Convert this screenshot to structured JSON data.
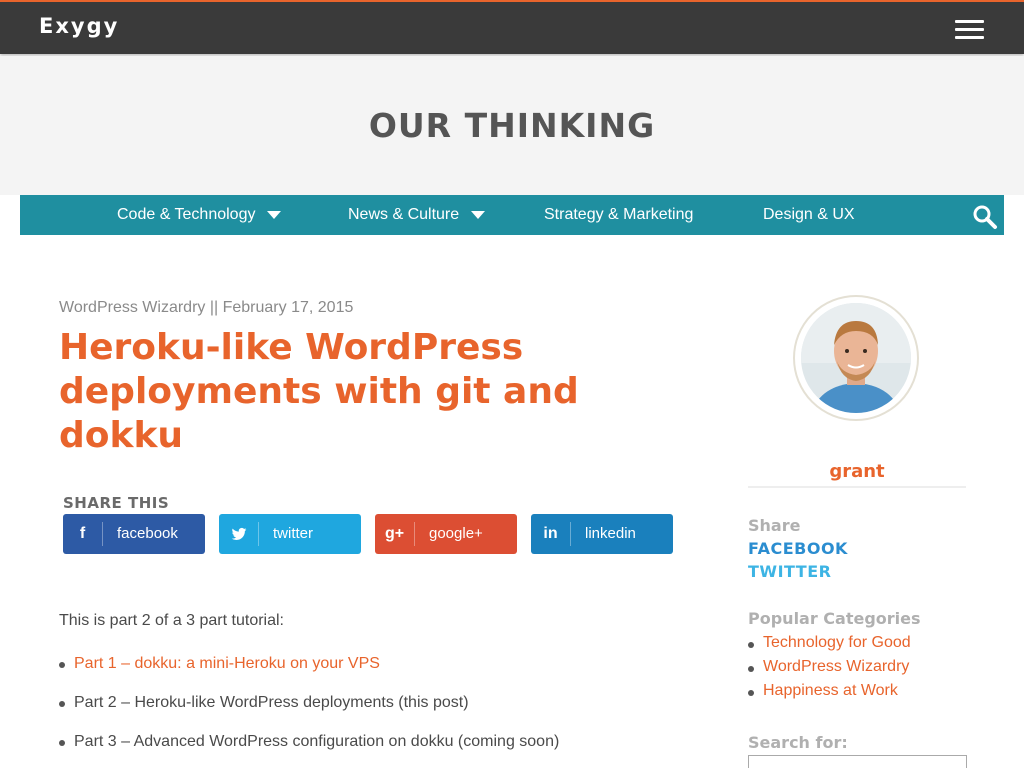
{
  "header": {
    "brand": "Exygy",
    "menu_icon": "hamburger-menu-icon"
  },
  "hero": {
    "title": "OUR THINKING"
  },
  "category_nav": {
    "items": [
      {
        "label": "Code & Technology",
        "has_dropdown": true
      },
      {
        "label": "News & Culture",
        "has_dropdown": true
      },
      {
        "label": "Strategy & Marketing",
        "has_dropdown": false
      },
      {
        "label": "Design & UX",
        "has_dropdown": false
      }
    ],
    "search_icon": "search-icon"
  },
  "post": {
    "category": "WordPress Wizardry",
    "separator": "||",
    "date": "February 17, 2015",
    "title": "Heroku-like WordPress deployments with git and dokku",
    "share_label": "SHARE THIS",
    "share_buttons": [
      {
        "label": "facebook",
        "icon": "f"
      },
      {
        "label": "twitter",
        "icon": "twitter-bird-icon"
      },
      {
        "label": "google+",
        "icon": "g+"
      },
      {
        "label": "linkedin",
        "icon": "in"
      }
    ],
    "intro": "This is part 2 of a 3 part tutorial:",
    "parts": [
      {
        "text": "Part 1 – dokku: a mini-Heroku on your VPS",
        "is_link": true
      },
      {
        "text": "Part 2 – Heroku-like WordPress deployments (this post)",
        "is_link": false
      },
      {
        "text": "Part 3 – Advanced WordPress configuration on dokku (coming soon)",
        "is_link": false
      }
    ]
  },
  "sidebar": {
    "author": "grant",
    "share_heading": "Share",
    "share_links": [
      "FACEBOOK",
      "TWITTER"
    ],
    "popular_heading": "Popular Categories",
    "popular": [
      "Technology for Good",
      "WordPress Wizardry",
      "Happiness at Work"
    ],
    "search_heading": "Search for:",
    "search_value": ""
  },
  "colors": {
    "accent": "#e8642c",
    "nav_bar": "#1f8fa0",
    "topbar": "#3a3a3a",
    "facebook": "#2d5aa5",
    "twitter": "#1fa7df",
    "google": "#dc4e33",
    "linkedin": "#1a80bd"
  }
}
